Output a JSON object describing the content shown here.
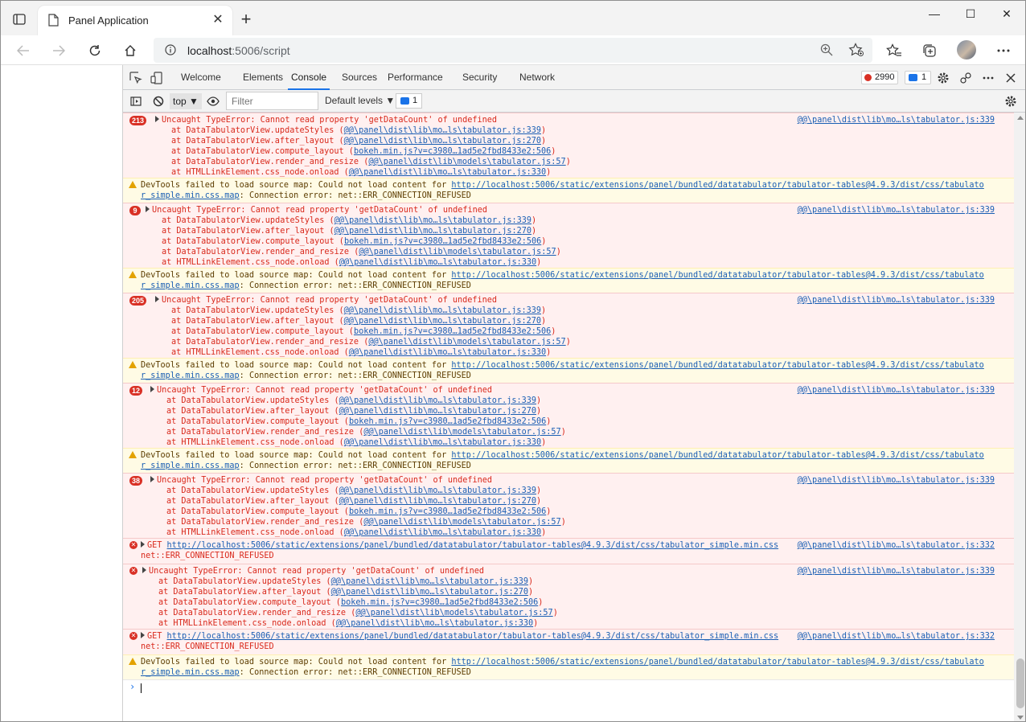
{
  "browser": {
    "tab_title": "Panel Application",
    "url_host": "localhost",
    "url_rest": ":5006/script",
    "window_minimize": "—",
    "window_maximize": "☐",
    "window_close": "✕",
    "new_tab": "+",
    "tab_close": "✕"
  },
  "devtools": {
    "tabs": [
      "Welcome",
      "Elements",
      "Console",
      "Sources",
      "Performance",
      "Security",
      "Network"
    ],
    "active_tab": "Console",
    "error_count": "2990",
    "message_count": "1",
    "context": "top",
    "filter_placeholder": "Filter",
    "levels": "Default levels",
    "issues_count": "1"
  },
  "console": {
    "type_error": "Uncaught TypeError: Cannot read property 'getDataCount' of undefined",
    "src_339": "@@\\panel\\dist\\lib\\mo…ls\\tabulator.js:339",
    "src_332": "@@\\panel\\dist\\lib\\mo…ls\\tabulator.js:332",
    "stack": [
      {
        "fn": "at DataTabulatorView.updateStyles (",
        "link": "@@\\panel\\dist\\lib\\mo…ls\\tabulator.js:339"
      },
      {
        "fn": "at DataTabulatorView.after_layout (",
        "link": "@@\\panel\\dist\\lib\\mo…ls\\tabulator.js:270"
      },
      {
        "fn": "at DataTabulatorView.compute_layout (",
        "link": "bokeh.min.js?v=c3980…1ad5e2fbd8433e2:506"
      },
      {
        "fn": "at DataTabulatorView.render_and_resize (",
        "link": "@@\\panel\\dist\\lib\\models\\tabulator.js:57"
      },
      {
        "fn": "at HTMLLinkElement.css_node.onload (",
        "link": "@@\\panel\\dist\\lib\\mo…ls\\tabulator.js:330"
      }
    ],
    "warn_prefix": "DevTools failed to load source map: Could not load content for ",
    "warn_link_1": "http://localhost:5006/static/extensions/panel/bundled/datatabulator/tabulator-tables@4.9.3/dist/css/tabulato",
    "warn_link_2": "r_simple.min.css.map",
    "warn_suffix": ": Connection error: net::ERR_CONNECTION_REFUSED",
    "get_prefix": "GET ",
    "get_link": "http://localhost:5006/static/extensions/panel/bundled/datatabulator/tabulator-tables@4.9.3/dist/css/tabulator_simple.min.css",
    "get_error": "net::ERR_CONNECTION_REFUSED",
    "badges": [
      "213",
      "9",
      "205",
      "12",
      "38"
    ],
    "prompt_caret": "›"
  }
}
